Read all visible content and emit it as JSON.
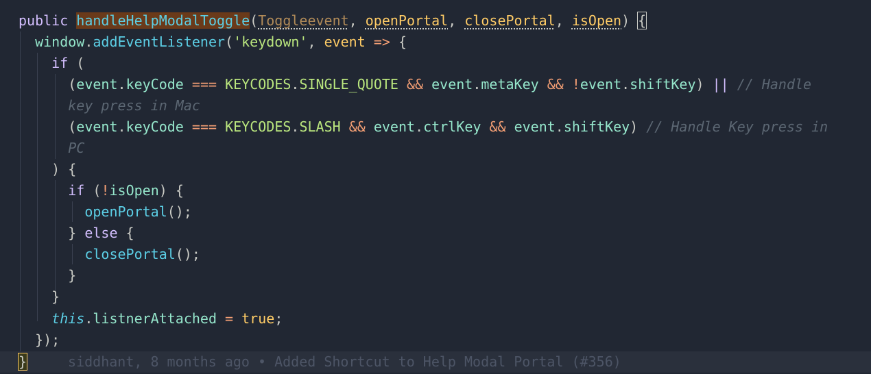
{
  "editor": {
    "lines": [
      {
        "tokens": [
          {
            "t": "public ",
            "c": "kw"
          },
          {
            "t": "handleHelpModalToggle",
            "c": "fn-decl"
          },
          {
            "t": "(",
            "c": "punc"
          },
          {
            "t": "Toggleevent",
            "c": "param-unused"
          },
          {
            "t": ", ",
            "c": "punc"
          },
          {
            "t": "openPortal",
            "c": "param"
          },
          {
            "t": ", ",
            "c": "punc"
          },
          {
            "t": "closePortal",
            "c": "param"
          },
          {
            "t": ", ",
            "c": "punc"
          },
          {
            "t": "isOpen",
            "c": "param"
          },
          {
            "t": ") ",
            "c": "punc"
          },
          {
            "t": "{",
            "c": "punc bracket-match"
          }
        ]
      },
      {
        "indent": "  ",
        "tokens": [
          {
            "t": "window",
            "c": "prop"
          },
          {
            "t": ".",
            "c": "punc"
          },
          {
            "t": "addEventListener",
            "c": "fn"
          },
          {
            "t": "(",
            "c": "punc"
          },
          {
            "t": "'keydown'",
            "c": "str"
          },
          {
            "t": ", ",
            "c": "punc"
          },
          {
            "t": "event",
            "c": "bool"
          },
          {
            "t": " => ",
            "c": "op"
          },
          {
            "t": "{",
            "c": "punc"
          }
        ]
      },
      {
        "indent": "    ",
        "tokens": [
          {
            "t": "if",
            "c": "kw"
          },
          {
            "t": " (",
            "c": "punc"
          }
        ]
      },
      {
        "indent": "      ",
        "tokens": [
          {
            "t": "(",
            "c": "punc"
          },
          {
            "t": "event",
            "c": "prop"
          },
          {
            "t": ".",
            "c": "punc"
          },
          {
            "t": "keyCode",
            "c": "prop"
          },
          {
            "t": " === ",
            "c": "op"
          },
          {
            "t": "KEYCODES",
            "c": "const"
          },
          {
            "t": ".",
            "c": "punc"
          },
          {
            "t": "SINGLE_QUOTE",
            "c": "const"
          },
          {
            "t": " && ",
            "c": "op"
          },
          {
            "t": "event",
            "c": "prop"
          },
          {
            "t": ".",
            "c": "punc"
          },
          {
            "t": "metaKey",
            "c": "prop"
          },
          {
            "t": " && ",
            "c": "op"
          },
          {
            "t": "!",
            "c": "op"
          },
          {
            "t": "event",
            "c": "prop"
          },
          {
            "t": ".",
            "c": "punc"
          },
          {
            "t": "shiftKey",
            "c": "prop"
          },
          {
            "t": ") ",
            "c": "punc"
          },
          {
            "t": "||",
            "c": "kw"
          },
          {
            "t": " // Handle",
            "c": "cmt"
          }
        ]
      },
      {
        "indent": "      ",
        "tokens": [
          {
            "t": "key press in Mac",
            "c": "cmt"
          }
        ]
      },
      {
        "indent": "      ",
        "tokens": [
          {
            "t": "(",
            "c": "punc"
          },
          {
            "t": "event",
            "c": "prop"
          },
          {
            "t": ".",
            "c": "punc"
          },
          {
            "t": "keyCode",
            "c": "prop"
          },
          {
            "t": " === ",
            "c": "op"
          },
          {
            "t": "KEYCODES",
            "c": "const"
          },
          {
            "t": ".",
            "c": "punc"
          },
          {
            "t": "SLASH",
            "c": "const"
          },
          {
            "t": " && ",
            "c": "op"
          },
          {
            "t": "event",
            "c": "prop"
          },
          {
            "t": ".",
            "c": "punc"
          },
          {
            "t": "ctrlKey",
            "c": "prop"
          },
          {
            "t": " && ",
            "c": "op"
          },
          {
            "t": "event",
            "c": "prop"
          },
          {
            "t": ".",
            "c": "punc"
          },
          {
            "t": "shiftKey",
            "c": "prop"
          },
          {
            "t": ") ",
            "c": "punc"
          },
          {
            "t": "// Handle Key press in",
            "c": "cmt"
          }
        ]
      },
      {
        "indent": "      ",
        "tokens": [
          {
            "t": "PC",
            "c": "cmt"
          }
        ]
      },
      {
        "indent": "    ",
        "tokens": [
          {
            "t": ") {",
            "c": "punc"
          }
        ]
      },
      {
        "indent": "      ",
        "tokens": [
          {
            "t": "if",
            "c": "kw"
          },
          {
            "t": " (",
            "c": "punc"
          },
          {
            "t": "!",
            "c": "op"
          },
          {
            "t": "isOpen",
            "c": "prop"
          },
          {
            "t": ") {",
            "c": "punc"
          }
        ]
      },
      {
        "indent": "        ",
        "tokens": [
          {
            "t": "openPortal",
            "c": "fn"
          },
          {
            "t": "();",
            "c": "punc"
          }
        ]
      },
      {
        "indent": "      ",
        "tokens": [
          {
            "t": "} ",
            "c": "punc"
          },
          {
            "t": "else",
            "c": "kw"
          },
          {
            "t": " {",
            "c": "punc"
          }
        ]
      },
      {
        "indent": "        ",
        "tokens": [
          {
            "t": "closePortal",
            "c": "fn"
          },
          {
            "t": "();",
            "c": "punc"
          }
        ]
      },
      {
        "indent": "      ",
        "tokens": [
          {
            "t": "}",
            "c": "punc"
          }
        ]
      },
      {
        "indent": "    ",
        "tokens": [
          {
            "t": "}",
            "c": "punc"
          }
        ]
      },
      {
        "indent": "    ",
        "tokens": [
          {
            "t": "this",
            "c": "kw-italic"
          },
          {
            "t": ".",
            "c": "punc"
          },
          {
            "t": "listnerAttached",
            "c": "prop"
          },
          {
            "t": " = ",
            "c": "op"
          },
          {
            "t": "true",
            "c": "bool"
          },
          {
            "t": ";",
            "c": "punc"
          }
        ]
      },
      {
        "indent": "  ",
        "tokens": [
          {
            "t": "});",
            "c": "punc"
          }
        ]
      },
      {
        "current": true,
        "tokens": [
          {
            "t": "}",
            "c": "punc cursor-bracket"
          },
          {
            "t": "siddhant, 8 months ago • Added Shortcut to Help Modal Portal (#356)",
            "c": "blame"
          }
        ]
      }
    ]
  }
}
